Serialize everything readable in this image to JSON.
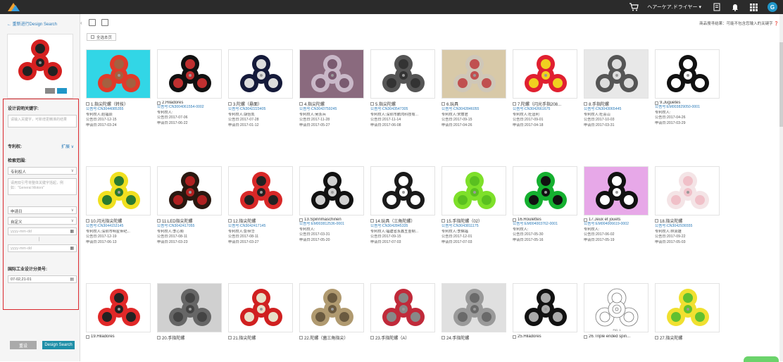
{
  "topbar": {
    "user_menu": "ヘアーケア.ドライヤー ▾",
    "avatar_letter": "G",
    "icons": [
      "cart-icon",
      "document-icon",
      "bell-icon",
      "apps-icon"
    ]
  },
  "left": {
    "back_link": "← 重新进行Design Search",
    "labels": {
      "keywords": "设计说明关键字:",
      "patentee": "专利权:",
      "expand": "扩展 ∨",
      "scope": "检索范围:",
      "loc": "国际工业设计分类号:"
    },
    "keywords_placeholder": "请输入关键字，可新增更精准的结果",
    "patentee_select": "专利权人",
    "patentee_placeholder": "请用双引号将整体关键字括起，例如：\"General Motors\"",
    "date_type": "申请日",
    "date_range": "自定义",
    "date_from": "yyyy-mm-dd",
    "date_sep": "|",
    "date_to": "yyyy-mm-dd",
    "loc_value": "07-02,21-01",
    "reset": "重设",
    "design_search": "Design Search"
  },
  "main": {
    "hint": "商品搜寻结果：可能不包含您输入的关键字",
    "select_all": "全选本页"
  },
  "results": [
    {
      "title": "1.指尖陀螺（转技）",
      "no": "公告号:CN3044085355",
      "owner": "专利权人:赵福辰",
      "pub": "公告日:2017-12-15",
      "app": "申请日:2017-03-24",
      "img": {
        "bg": "#32d6e6",
        "color": "#e03a2a",
        "center": "#a56040"
      }
    },
    {
      "title": "2.Hiladores",
      "no": "公告号:CN3004061554-0002",
      "owner": "专利权人:",
      "pub": "公告日:2017-07-06",
      "app": "申请日:2017-06-22",
      "img": {
        "bg": "#ffffff",
        "color": "#111111",
        "center": "#c03030"
      }
    },
    {
      "title": "3.陀螺（悬面）",
      "no": "公告号:CN3042223405",
      "owner": "专利权人:胡怡凯",
      "pub": "公告日:2017-07-28",
      "app": "申请日:2017-01-12",
      "img": {
        "bg": "#ffffff",
        "color": "#151a3a",
        "center": "#dddddd"
      }
    },
    {
      "title": "4.指尖陀螺",
      "no": "公告号:CN3043759245",
      "owner": "专利权人:吴永兵",
      "pub": "公告日:2017-11-28",
      "app": "申请日:2017-05-27",
      "img": {
        "bg": "#8a6a7e",
        "color": "#c9b8c8",
        "center": "#7a5a70"
      }
    },
    {
      "title": "5.指尖陀螺",
      "no": "公告号:CN3043547305",
      "owner": "专利权人:深圳市鹏鸿科技有...",
      "pub": "公告日:2017-11-14",
      "app": "申请日:2017-06-08",
      "img": {
        "bg": "#ffffff",
        "color": "#555555",
        "center": "#333333"
      }
    },
    {
      "title": "6.玩具",
      "no": "公告号:CN3042846055",
      "owner": "专利权人:宋丽君",
      "pub": "公告日:2017-09-15",
      "app": "申请日:2017-04-26",
      "img": {
        "bg": "#d8c9a8",
        "color": "#cfc7b8",
        "center": "#c05050"
      }
    },
    {
      "title": "7.陀螺（闪光手指208...",
      "no": "公告号:CN3042661675",
      "owner": "专利权人:杜运利",
      "pub": "公告日:2017-09-01",
      "app": "申请日:2017-04-18",
      "img": {
        "bg": "#ffffff",
        "color": "#e02030",
        "center": "#f0d020"
      }
    },
    {
      "title": "8.手指陀螺",
      "no": "公告号:CN3043065445",
      "owner": "专利权人:杜喜山",
      "pub": "公告日:2017-10-03",
      "app": "申请日:2017-03-31",
      "img": {
        "bg": "#e8e8e8",
        "color": "#555555",
        "center": "#dddddd"
      }
    },
    {
      "title": "9.Juguetes",
      "no": "公告号:EM003829050-0001",
      "owner": "专利权人:",
      "pub": "公告日:2017-04-26",
      "app": "申请日:2017-03-29",
      "img": {
        "bg": "#ffffff",
        "color": "#111111",
        "center": "#ffffff"
      }
    },
    {
      "title": "10.闪光指尖陀螺",
      "no": "公告号:CN3044153145",
      "owner": "专利权人:深圳市明星世纪...",
      "pub": "公告日:2017-12-19",
      "app": "申请日:2017-06-13",
      "img": {
        "bg": "#ffffff",
        "color": "#f0e020",
        "center": "#2a7a30"
      }
    },
    {
      "title": "11.LED指尖陀螺",
      "no": "公告号:CN3042417055",
      "owner": "专利权人:李心频",
      "pub": "公告日:2017-08-11",
      "app": "申请日:2017-03-23",
      "img": {
        "bg": "#ffffff",
        "color": "#2a1810",
        "center": "#b02020"
      }
    },
    {
      "title": "12.指尖陀螺",
      "no": "公告号:CN3042417145",
      "owner": "专利权人:彭世华",
      "pub": "公告日:2017-08-11",
      "app": "申请日:2017-03-27",
      "img": {
        "bg": "#ffffff",
        "color": "#d82828",
        "center": "#222222"
      }
    },
    {
      "title": "13.Spinnmaschinen",
      "no": "公告号:EM003812536-0001",
      "owner": "专利权人:",
      "pub": "公告日:2017-03-31",
      "app": "申请日:2017-05-20",
      "img": {
        "bg": "#ffffff",
        "color": "#111111",
        "center": "#d0d0d0"
      }
    },
    {
      "title": "14.玩具（三角陀螺）",
      "no": "公告号:CN3042845335",
      "owner": "专利权人:福建省永鑫五金制...",
      "pub": "公告日:2017-09-15",
      "app": "申请日:2017-07-03",
      "img": {
        "bg": "#ffffff",
        "color": "#1a1a1a",
        "center": "#ffffff"
      }
    },
    {
      "title": "15.手指陀螺（02）",
      "no": "公告号:CN3043811175",
      "owner": "专利权人:李琳福",
      "pub": "公告日:2017-12-01",
      "app": "申请日:2017-07-03",
      "img": {
        "bg": "#ffffff",
        "color": "#7ee02a",
        "center": "#5ac020"
      }
    },
    {
      "title": "16.Roulettes",
      "no": "公告号:EM004003762-0001",
      "owner": "专利权人:",
      "pub": "公告日:2017-05-30",
      "app": "申请日:2017-05-16",
      "img": {
        "bg": "#ffffff",
        "color": "#15b030",
        "center": "#111111"
      }
    },
    {
      "title": "17.Jeux et jouets",
      "no": "公告号:EM004006619-0002",
      "owner": "专利权人:",
      "pub": "公告日:2017-06-02",
      "app": "申请日:2017-05-19",
      "img": {
        "bg": "#e7a8e8",
        "color": "#111111",
        "center": "#ffffff"
      }
    },
    {
      "title": "18.指尖陀螺",
      "no": "公告号:CN3042936555",
      "owner": "专利权人:林贤雄",
      "pub": "公告日:2017-09-22",
      "app": "申请日:2017-05-03",
      "img": {
        "bg": "#ffffff",
        "color": "#f4e4e6",
        "center": "#f0c0c8"
      }
    },
    {
      "title": "19.Hiladores",
      "no": "",
      "owner": "",
      "pub": "",
      "app": "",
      "img": {
        "bg": "#ffffff",
        "color": "#e02828",
        "center": "#222222"
      }
    },
    {
      "title": "20.手指陀螺",
      "no": "",
      "owner": "",
      "pub": "",
      "app": "",
      "img": {
        "bg": "#d0d0d0",
        "color": "#666666",
        "center": "#444444"
      }
    },
    {
      "title": "21.指尖陀螺",
      "no": "",
      "owner": "",
      "pub": "",
      "app": "",
      "img": {
        "bg": "#ffffff",
        "color": "#d02020",
        "center": "#e8e0c8"
      }
    },
    {
      "title": "22.陀螺（菌三角指尖）",
      "no": "",
      "owner": "",
      "pub": "",
      "app": "",
      "img": {
        "bg": "#ffffff",
        "color": "#b09a70",
        "center": "#6a5a40"
      }
    },
    {
      "title": "23.手指陀螺（A）",
      "no": "",
      "owner": "",
      "pub": "",
      "app": "",
      "img": {
        "bg": "#ffffff",
        "color": "#c02a3a",
        "center": "#888888"
      }
    },
    {
      "title": "24.手指陀螺",
      "no": "",
      "owner": "",
      "pub": "",
      "app": "",
      "img": {
        "bg": "#e0e0e0",
        "color": "#9a9a9a",
        "center": "#6a6a6a"
      }
    },
    {
      "title": "25.Hiladores",
      "no": "",
      "owner": "",
      "pub": "",
      "app": "",
      "img": {
        "bg": "#ffffff",
        "color": "#111111",
        "center": "#aaaaaa"
      }
    },
    {
      "title": "26.Triple ended spin...",
      "no": "",
      "owner": "",
      "pub": "",
      "app": "",
      "img": {
        "bg": "#ffffff",
        "color": "#ffffff",
        "center": "#ffffff",
        "outline": true,
        "caption": "FIG. 1"
      }
    },
    {
      "title": "27.指尖陀螺",
      "no": "",
      "owner": "",
      "pub": "",
      "app": "",
      "img": {
        "bg": "#ffffff",
        "color": "#f0e030",
        "center": "#60c030"
      }
    }
  ]
}
